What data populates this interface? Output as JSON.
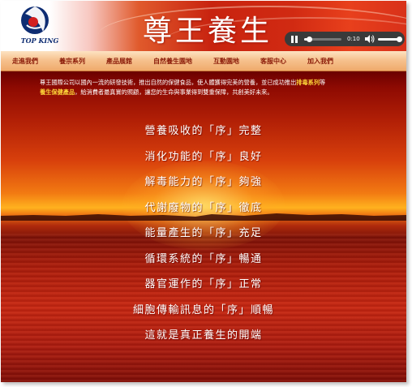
{
  "header": {
    "logo_text": "TOP KING",
    "site_title": "尊王養生",
    "player": {
      "time": "0:10",
      "progress": 0.12,
      "volume": 1.0
    }
  },
  "nav": {
    "items": [
      "走進我們",
      "養宗系列",
      "產品展館",
      "自然養生園地",
      "互動園地",
      "客服中心",
      "加入我們"
    ]
  },
  "content": {
    "intro_line1_a": "尊王國際公司以國內一流的研發技術，推出自然的保健食品，使人體獲得完美的營養，並已成功推出",
    "intro_line1_hl": "排毒系列",
    "intro_line1_b": "等",
    "intro_line2_hl": "養生保健產品",
    "intro_line2_b": "，給消費者最真實的照顧，讓您的生命與事業得到雙重保障，共創美好未來。",
    "verses": [
      "營養吸收的「序」完整",
      "消化功能的「序」良好",
      "解毒能力的「序」夠強",
      "代謝廢物的「序」徹底",
      "能量產生的「序」充足",
      "循環系統的「序」暢通",
      "器官運作的「序」正常",
      "細胞傳輸訊息的「序」順暢",
      "這就是真正養生的開端"
    ]
  },
  "colors": {
    "nav_text": "#8a1a08",
    "highlight": "#ffd83a",
    "logo_blue": "#0e2d73",
    "logo_red": "#d21f1f"
  }
}
